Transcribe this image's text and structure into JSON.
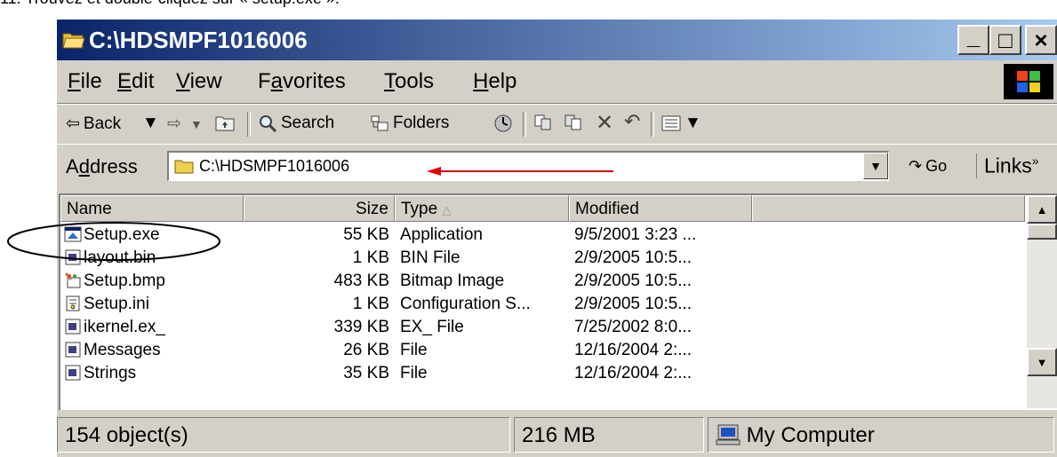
{
  "caption": "11. Trouvez et double-cliquez sur « setup.exe ».",
  "window": {
    "title": "C:\\HDSMPF1016006",
    "controls": {
      "minimize": "_",
      "maximize": "□",
      "close": "×"
    }
  },
  "menu": [
    {
      "pre": "",
      "key": "F",
      "post": "ile"
    },
    {
      "pre": "",
      "key": "E",
      "post": "dit"
    },
    {
      "pre": "",
      "key": "V",
      "post": "iew"
    },
    {
      "pre": "F",
      "key": "a",
      "post": "vorites"
    },
    {
      "pre": "",
      "key": "T",
      "post": "ools"
    },
    {
      "pre": "",
      "key": "H",
      "post": "elp"
    }
  ],
  "toolbar": {
    "back": "Back",
    "search": "Search",
    "folders": "Folders"
  },
  "address": {
    "label_pre": "A",
    "label_key": "d",
    "label_post": "dress",
    "value": "C:\\HDSMPF1016006",
    "go": "Go",
    "links": "Links",
    "links_chevron": "»"
  },
  "columns": {
    "name": "Name",
    "size": "Size",
    "type": "Type",
    "modified": "Modified"
  },
  "files": [
    {
      "name": "Setup.exe",
      "size": "55 KB",
      "type": "Application",
      "modified": "9/5/2001 3:23 ...",
      "icon": "setup-exe-icon"
    },
    {
      "name": "layout.bin",
      "size": "1 KB",
      "type": "BIN File",
      "modified": "2/9/2005 10:5...",
      "icon": "bin-file-icon"
    },
    {
      "name": "Setup.bmp",
      "size": "483 KB",
      "type": "Bitmap Image",
      "modified": "2/9/2005 10:5...",
      "icon": "bitmap-icon"
    },
    {
      "name": "Setup.ini",
      "size": "1 KB",
      "type": "Configuration S...",
      "modified": "2/9/2005 10:5...",
      "icon": "config-file-icon"
    },
    {
      "name": "ikernel.ex_",
      "size": "339 KB",
      "type": "EX_ File",
      "modified": "7/25/2002 8:0...",
      "icon": "ex-file-icon"
    },
    {
      "name": "Messages",
      "size": "26 KB",
      "type": "File",
      "modified": "12/16/2004 2:...",
      "icon": "generic-file-icon"
    },
    {
      "name": "Strings",
      "size": "35 KB",
      "type": "File",
      "modified": "12/16/2004 2:...",
      "icon": "generic-file-icon"
    }
  ],
  "status": {
    "objects": "154 object(s)",
    "size": "216 MB",
    "zone": "My Computer"
  }
}
